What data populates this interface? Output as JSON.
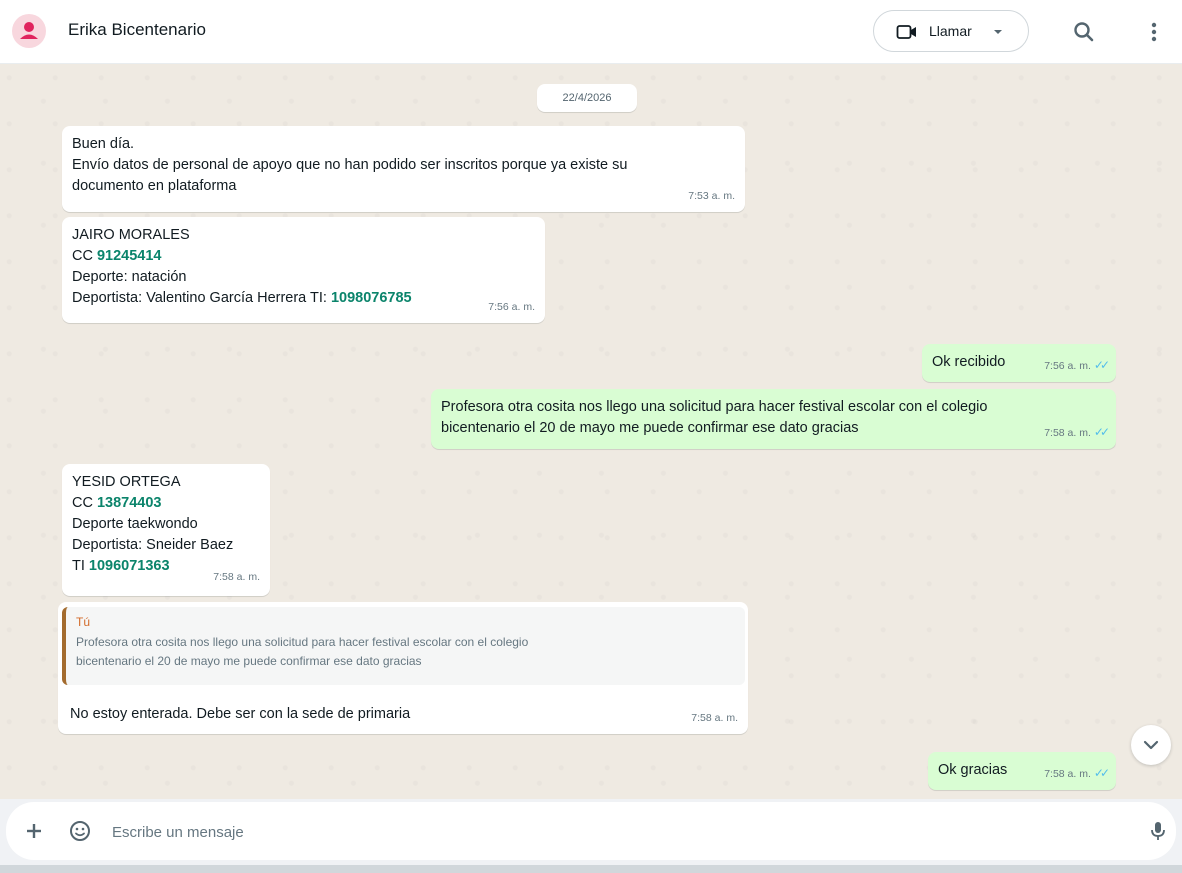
{
  "header": {
    "contact_name": "Erika Bicentenario",
    "call_label": "Llamar",
    "icons": {
      "avatar": "person-icon",
      "call": "video-camera-icon",
      "caret": "chevron-down-icon",
      "search": "search-icon",
      "menu": "more-vertical-icon"
    }
  },
  "chat": {
    "date": "22/4/2026",
    "messages": [
      {
        "direction": "in",
        "lines": [
          "Buen día.",
          "Envío datos de personal de apoyo que no han podido ser inscritos porque ya existe su",
          "documento en plataforma"
        ],
        "time": "7:53 a. m."
      },
      {
        "direction": "in",
        "name": "JAIRO MORALES",
        "cc_prefix": "CC ",
        "cc": "91245414",
        "sport": "Deporte: natación",
        "athlete_prefix": "Deportista: Valentino García Herrera TI: ",
        "ti": "1098076785",
        "time": "7:56 a. m."
      },
      {
        "direction": "out",
        "text": "Ok recibido",
        "time": "7:56 a. m."
      },
      {
        "direction": "out",
        "lines": [
          "Profesora otra cosita nos llego una solicitud para hacer festival escolar  con el colegio",
          "bicentenario el 20 de mayo me puede confirmar ese dato gracias"
        ],
        "time": "7:58 a. m."
      },
      {
        "direction": "in",
        "name": "YESID ORTEGA",
        "cc_prefix": "CC ",
        "cc": "13874403",
        "sport": "Deporte taekwondo",
        "athlete": "Deportista: Sneider Baez",
        "ti_prefix": "TI ",
        "ti": "1096071363",
        "time": "7:58 a. m."
      },
      {
        "direction": "in",
        "quote_author": "Tú",
        "quote_lines": [
          "Profesora otra cosita nos llego una solicitud para hacer festival escolar  con el colegio",
          "bicentenario el 20 de mayo me puede confirmar ese dato gracias"
        ],
        "text": "No estoy enterada. Debe ser con la sede de primaria",
        "time": "7:58 a. m."
      },
      {
        "direction": "out",
        "text": "Ok gracias",
        "time": "7:58 a. m."
      }
    ]
  },
  "composer": {
    "placeholder": "Escribe un mensaje",
    "icons": {
      "plus": "plus-icon",
      "sticker": "sticker-icon",
      "mic": "microphone-icon"
    }
  },
  "colors": {
    "incoming": "#ffffff",
    "outgoing": "#d9fdd3",
    "background": "#efeae2",
    "read_ticks": "#53bdeb",
    "number_link": "#0b846b"
  }
}
